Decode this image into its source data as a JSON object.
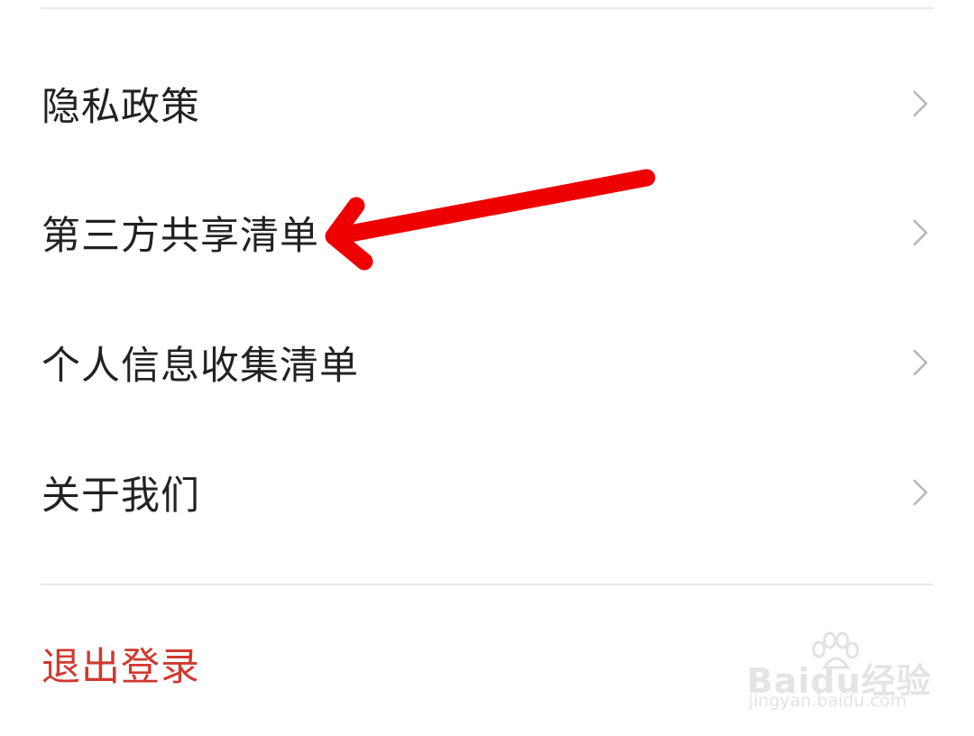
{
  "menu": {
    "items": [
      {
        "label": "隐私政策"
      },
      {
        "label": "第三方共享清单"
      },
      {
        "label": "个人信息收集清单"
      },
      {
        "label": "关于我们"
      }
    ]
  },
  "logout": {
    "label": "退出登录",
    "color": "#d0392f"
  },
  "annotation": {
    "arrow_color": "#ee0000"
  },
  "watermark": {
    "logo_text": "Baidu经验",
    "url": "jingyan.baidu.com"
  },
  "icons": {
    "chevron": "chevron-right-icon"
  }
}
